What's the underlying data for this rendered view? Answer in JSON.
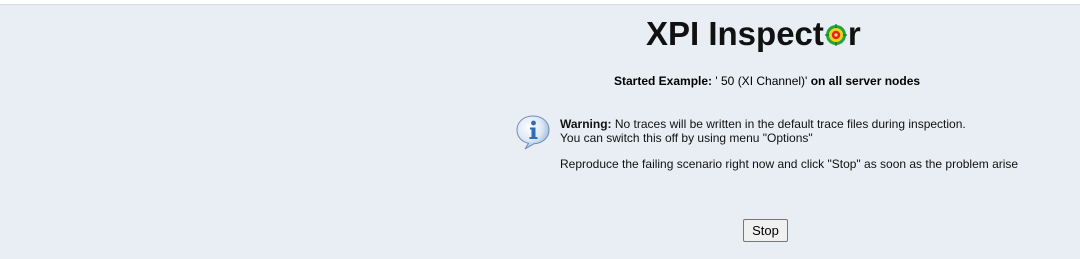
{
  "app": {
    "title_before": "XPI Inspect",
    "title_after": "r"
  },
  "started": {
    "label": "Started Example:",
    "value": " ' 50 (XI Channel)' ",
    "suffix": "on all server nodes"
  },
  "warning": {
    "label": "Warning:",
    "line1": " No traces will be written in the default trace files during inspection.",
    "line2": "You can switch this off by using menu \"Options\"",
    "reproduce": "Reproduce the failing scenario right now and click \"Stop\" as soon as the problem arise"
  },
  "buttons": {
    "stop": "Stop"
  },
  "icons": {
    "title_o": "target-icon",
    "info": "info-icon"
  },
  "colors": {
    "background": "#e8eef4",
    "target_green": "#22a33b",
    "target_red": "#e0261c",
    "target_yellow": "#f2d21b",
    "info_blue": "#2f6db5"
  }
}
